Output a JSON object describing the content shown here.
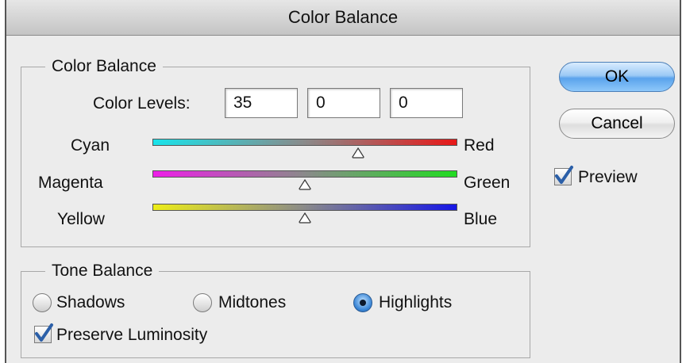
{
  "window": {
    "title": "Color Balance"
  },
  "color_balance": {
    "legend": "Color Balance",
    "levels_label": "Color Levels:",
    "levels": [
      "35",
      "0",
      "0"
    ],
    "sliders": [
      {
        "left": "Cyan",
        "right": "Red",
        "value": 35,
        "colors": [
          "#19e3ea",
          "#e81818"
        ]
      },
      {
        "left": "Magenta",
        "right": "Green",
        "value": 0,
        "colors": [
          "#ee1ee8",
          "#22dc22"
        ]
      },
      {
        "left": "Yellow",
        "right": "Blue",
        "value": 0,
        "colors": [
          "#eded18",
          "#1616e6"
        ]
      }
    ]
  },
  "tone_balance": {
    "legend": "Tone Balance",
    "options": [
      "Shadows",
      "Midtones",
      "Highlights"
    ],
    "selected": "Highlights",
    "preserve_luminosity_label": "Preserve Luminosity",
    "preserve_luminosity_checked": true
  },
  "buttons": {
    "ok": "OK",
    "cancel": "Cancel"
  },
  "preview": {
    "label": "Preview",
    "checked": true
  }
}
